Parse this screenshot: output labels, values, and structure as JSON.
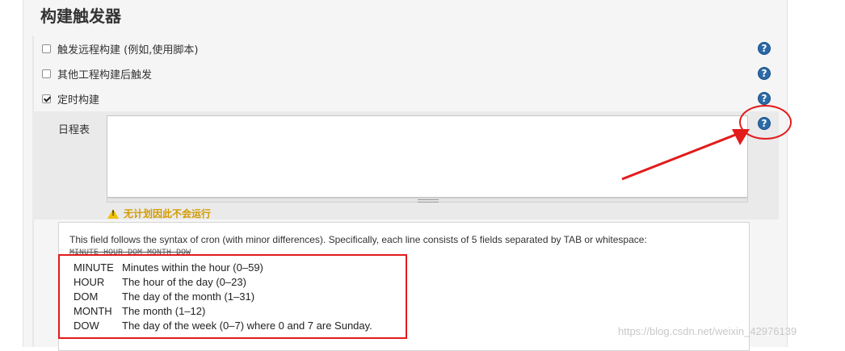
{
  "section": {
    "title": "构建触发器"
  },
  "triggers": [
    {
      "label": "触发远程构建 (例如,使用脚本)",
      "checked": false
    },
    {
      "label": "其他工程构建后触发",
      "checked": false
    },
    {
      "label": "定时构建",
      "checked": true
    }
  ],
  "schedule": {
    "label": "日程表",
    "value": "",
    "warning": "无计划因此不会运行"
  },
  "help_text": {
    "intro": "This field follows the syntax of cron (with minor differences). Specifically, each line consists of 5 fields separated by TAB or whitespace:",
    "syntax": "MINUTE HOUR DOM MONTH DOW",
    "fields": [
      {
        "key": "MINUTE",
        "desc": "Minutes within the hour (0–59)"
      },
      {
        "key": "HOUR",
        "desc": "The hour of the day (0–23)"
      },
      {
        "key": "DOM",
        "desc": "The day of the month (1–31)"
      },
      {
        "key": "MONTH",
        "desc": "The month (1–12)"
      },
      {
        "key": "DOW",
        "desc": "The day of the week (0–7) where 0 and 7 are Sunday."
      }
    ]
  },
  "help_icon_glyph": "?",
  "watermark": "https://blog.csdn.net/weixin_42976139",
  "colors": {
    "help_icon": "#2b6aa8",
    "annotation": "#e21b1b",
    "warning": "#d29b00"
  }
}
